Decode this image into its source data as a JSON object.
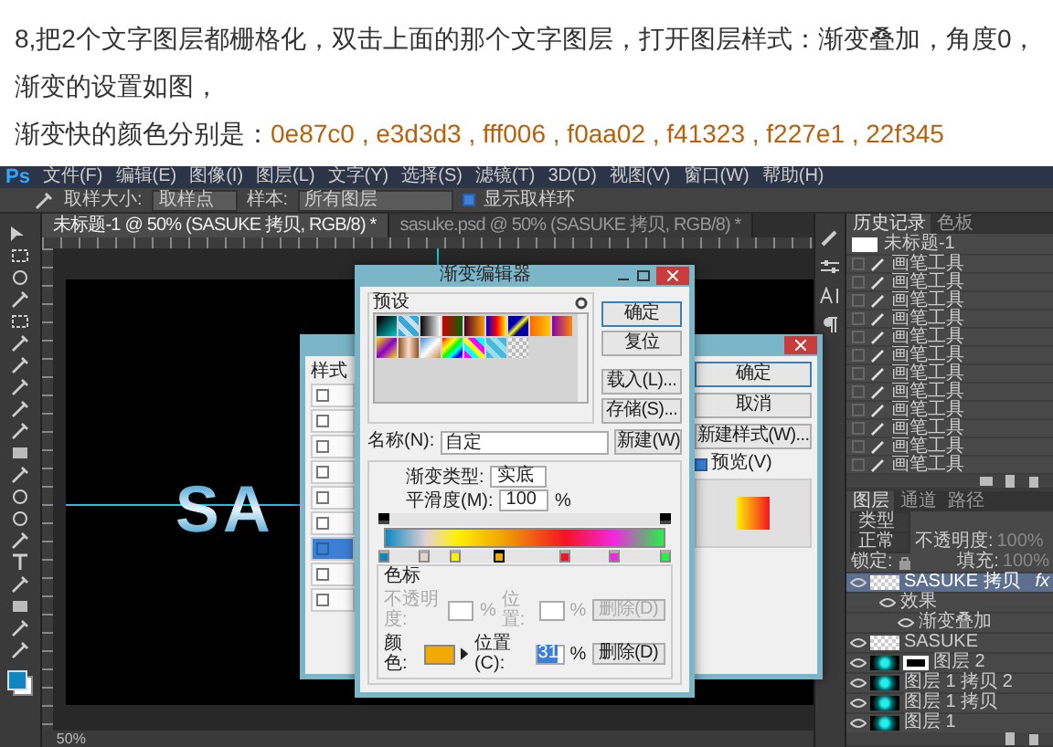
{
  "article": {
    "paragraph": "8,把2个文字图层都栅格化，双击上面的那个文字图层，打开图层样式：渐变叠加，角度0，渐变的设置如图，",
    "colors_label": "渐变快的颜色分别是：",
    "color_codes": "0e87c0 , e3d3d3 , fff006 , f0aa02 , f41323 , f227e1 , 22f345"
  },
  "app": {
    "logo": "Ps",
    "menu": [
      "文件(F)",
      "编辑(E)",
      "图像(I)",
      "图层(L)",
      "文字(Y)",
      "选择(S)",
      "滤镜(T)",
      "3D(D)",
      "视图(V)",
      "窗口(W)",
      "帮助(H)"
    ],
    "options_bar": {
      "sample_size_label": "取样大小:",
      "sample_size": "取样点",
      "sample_label": "样本:",
      "sample": "所有图层",
      "show_ring": {
        "label": "显示取样环",
        "checked": true
      }
    },
    "tabs": [
      {
        "label": "未标题-1 @ 50% (SASUKE 拷贝, RGB/8) *",
        "selected": true
      },
      {
        "label": "sasuke.psd @ 50% (SASUKE 拷贝, RGB/8) *",
        "selected": false
      }
    ],
    "canvas": {
      "text": "SA"
    },
    "status_bar": {
      "zoom": "50%"
    }
  },
  "gradient_editor": {
    "title": "渐变编辑器",
    "presets_label": "预设",
    "buttons": [
      "确定",
      "复位",
      "载入(L)...",
      "存储(S)..."
    ],
    "name_label": "名称(N):",
    "name": "自定",
    "new_button": "新建(W)",
    "type_label": "渐变类型:",
    "type": "实底",
    "smoothness_label": "平滑度(M):",
    "smoothness": "100",
    "smoothness_unit": "%",
    "opacity_stops": [
      {
        "level": 0,
        "selected": false
      },
      {
        "level": 1,
        "selected": false
      }
    ],
    "color_stops": [
      {
        "color": "#0e87c0",
        "level": 0,
        "selected": false
      },
      {
        "color": "#e3d3d3",
        "level": 0.145,
        "selected": false
      },
      {
        "color": "#fff006",
        "level": 0.255,
        "selected": false
      },
      {
        "color": "#f0aa02",
        "level": 0.41,
        "selected": true
      },
      {
        "color": "#f41323",
        "level": 0.645,
        "selected": false
      },
      {
        "color": "#f227e1",
        "level": 0.82,
        "selected": false
      },
      {
        "color": "#22f345",
        "level": 1,
        "selected": false
      }
    ],
    "stops_group": {
      "title": "色标",
      "opacity_label": "不透明度:",
      "opacity_unit": "%",
      "opacity_location_label": "位置:",
      "opacity_location_unit": "%",
      "opacity_delete": "删除(D)",
      "opacity_disabled": true,
      "color_label": "颜色:",
      "location_label": "位置(C):",
      "location": "31",
      "location_unit": "%",
      "delete": "删除(D)"
    }
  },
  "layer_style": {
    "styles_label": "样式",
    "effects": [
      {
        "checked": false,
        "selected": false
      },
      {
        "checked": false,
        "selected": false
      },
      {
        "checked": false,
        "selected": false
      },
      {
        "checked": false,
        "selected": false
      },
      {
        "checked": false,
        "selected": false
      },
      {
        "checked": false,
        "selected": false
      },
      {
        "checked": true,
        "selected": true
      },
      {
        "checked": false,
        "selected": false
      },
      {
        "checked": false,
        "selected": false
      }
    ],
    "buttons": [
      "确定",
      "取消",
      "新建样式(W)..."
    ],
    "preview": {
      "label": "预览(V)",
      "checked": true
    }
  },
  "history": {
    "tabs": [
      {
        "label": "历史记录",
        "selected": true
      },
      {
        "label": "色板",
        "selected": false
      }
    ],
    "snapshot": "未标题-1",
    "steps": [
      "画笔工具",
      "画笔工具",
      "画笔工具",
      "画笔工具",
      "画笔工具",
      "画笔工具",
      "画笔工具",
      "画笔工具",
      "画笔工具",
      "画笔工具",
      "画笔工具",
      "画笔工具"
    ]
  },
  "layers": {
    "tabs": [
      {
        "label": "图层",
        "selected": true
      },
      {
        "label": "通道",
        "selected": false
      },
      {
        "label": "路径",
        "selected": false
      }
    ],
    "filter": "类型",
    "blend_mode": "正常",
    "opacity_label": "不透明度:",
    "opacity": "100%",
    "lock_label": "锁定:",
    "fill_label": "填充:",
    "fill": "100%",
    "items": [
      {
        "name": "SASUKE 拷贝",
        "kind": "checker",
        "visible": true,
        "selected": true,
        "badge": "fx",
        "children": [
          {
            "name": "效果",
            "visible": true,
            "children": [
              {
                "name": "渐变叠加",
                "visible": true
              }
            ]
          }
        ]
      },
      {
        "name": "SASUKE",
        "kind": "checker",
        "visible": true,
        "selected": false
      },
      {
        "name": "图层 2",
        "kind": "masked",
        "visible": true,
        "selected": false
      },
      {
        "name": "图层 1 拷贝 2",
        "kind": "glow",
        "visible": true,
        "selected": false
      },
      {
        "name": "图层 1 拷贝",
        "kind": "glow",
        "visible": true,
        "selected": false
      },
      {
        "name": "图层 1",
        "kind": "glow",
        "visible": true,
        "selected": false
      }
    ]
  }
}
